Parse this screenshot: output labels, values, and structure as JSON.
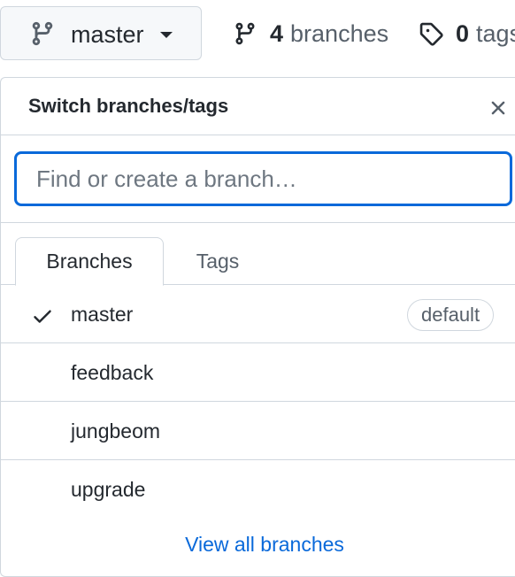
{
  "branch_selector": {
    "current_branch": "master",
    "icon": "git-branch-icon"
  },
  "stats": {
    "branches": {
      "count": "4",
      "label": "branches",
      "icon": "git-branch-icon"
    },
    "tags": {
      "count": "0",
      "label": "tags",
      "icon": "tag-icon"
    }
  },
  "panel": {
    "title": "Switch branches/tags",
    "close_icon": "close-icon",
    "filter_placeholder": "Find or create a branch…",
    "filter_value": "",
    "tabs": [
      {
        "label": "Branches",
        "selected": true
      },
      {
        "label": "Tags",
        "selected": false
      }
    ],
    "branches": [
      {
        "name": "master",
        "selected": true,
        "badge": "default"
      },
      {
        "name": "feedback",
        "selected": false
      },
      {
        "name": "jungbeom",
        "selected": false
      },
      {
        "name": "upgrade",
        "selected": false
      }
    ],
    "view_all_label": "View all branches"
  },
  "colors": {
    "accent": "#0969da",
    "border": "#d0d7de",
    "text": "#24292f",
    "muted": "#57606a"
  }
}
